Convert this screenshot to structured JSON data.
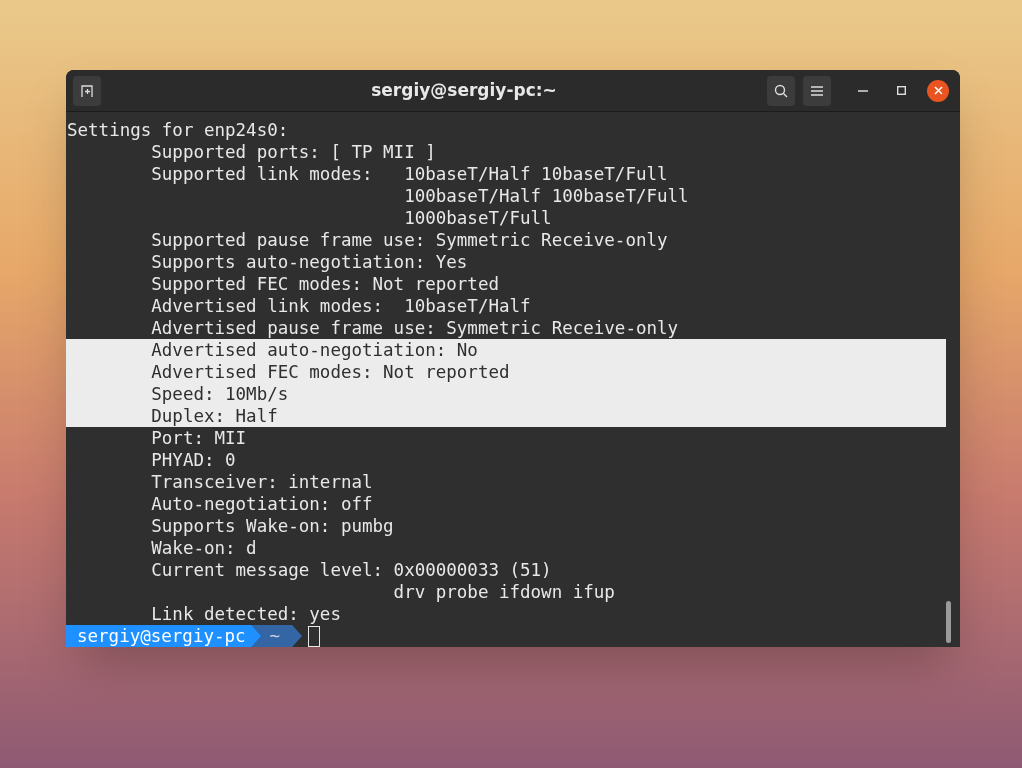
{
  "window": {
    "title": "sergiy@sergiy-pc:~"
  },
  "lines": [
    {
      "text": "Settings for enp24s0:",
      "selected": false
    },
    {
      "text": "        Supported ports: [ TP MII ]",
      "selected": false
    },
    {
      "text": "        Supported link modes:   10baseT/Half 10baseT/Full",
      "selected": false
    },
    {
      "text": "                                100baseT/Half 100baseT/Full",
      "selected": false
    },
    {
      "text": "                                1000baseT/Full",
      "selected": false
    },
    {
      "text": "        Supported pause frame use: Symmetric Receive-only",
      "selected": false
    },
    {
      "text": "        Supports auto-negotiation: Yes",
      "selected": false
    },
    {
      "text": "        Supported FEC modes: Not reported",
      "selected": false
    },
    {
      "text": "        Advertised link modes:  10baseT/Half",
      "selected": false
    },
    {
      "text": "        Advertised pause frame use: Symmetric Receive-only",
      "selected": false
    },
    {
      "text": "        Advertised auto-negotiation: No",
      "selected": true
    },
    {
      "text": "        Advertised FEC modes: Not reported",
      "selected": true
    },
    {
      "text": "        Speed: 10Mb/s",
      "selected": true
    },
    {
      "text": "        Duplex: Half",
      "selected": true
    },
    {
      "text": "        Port: MII",
      "selected": false
    },
    {
      "text": "        PHYAD: 0",
      "selected": false
    },
    {
      "text": "        Transceiver: internal",
      "selected": false
    },
    {
      "text": "        Auto-negotiation: off",
      "selected": false
    },
    {
      "text": "        Supports Wake-on: pumbg",
      "selected": false
    },
    {
      "text": "        Wake-on: d",
      "selected": false
    },
    {
      "text": "        Current message level: 0x00000033 (51)",
      "selected": false
    },
    {
      "text": "                               drv probe ifdown ifup",
      "selected": false
    },
    {
      "text": "        Link detected: yes",
      "selected": false
    }
  ],
  "prompt": {
    "user": "sergiy@sergiy-pc",
    "path": "~"
  }
}
